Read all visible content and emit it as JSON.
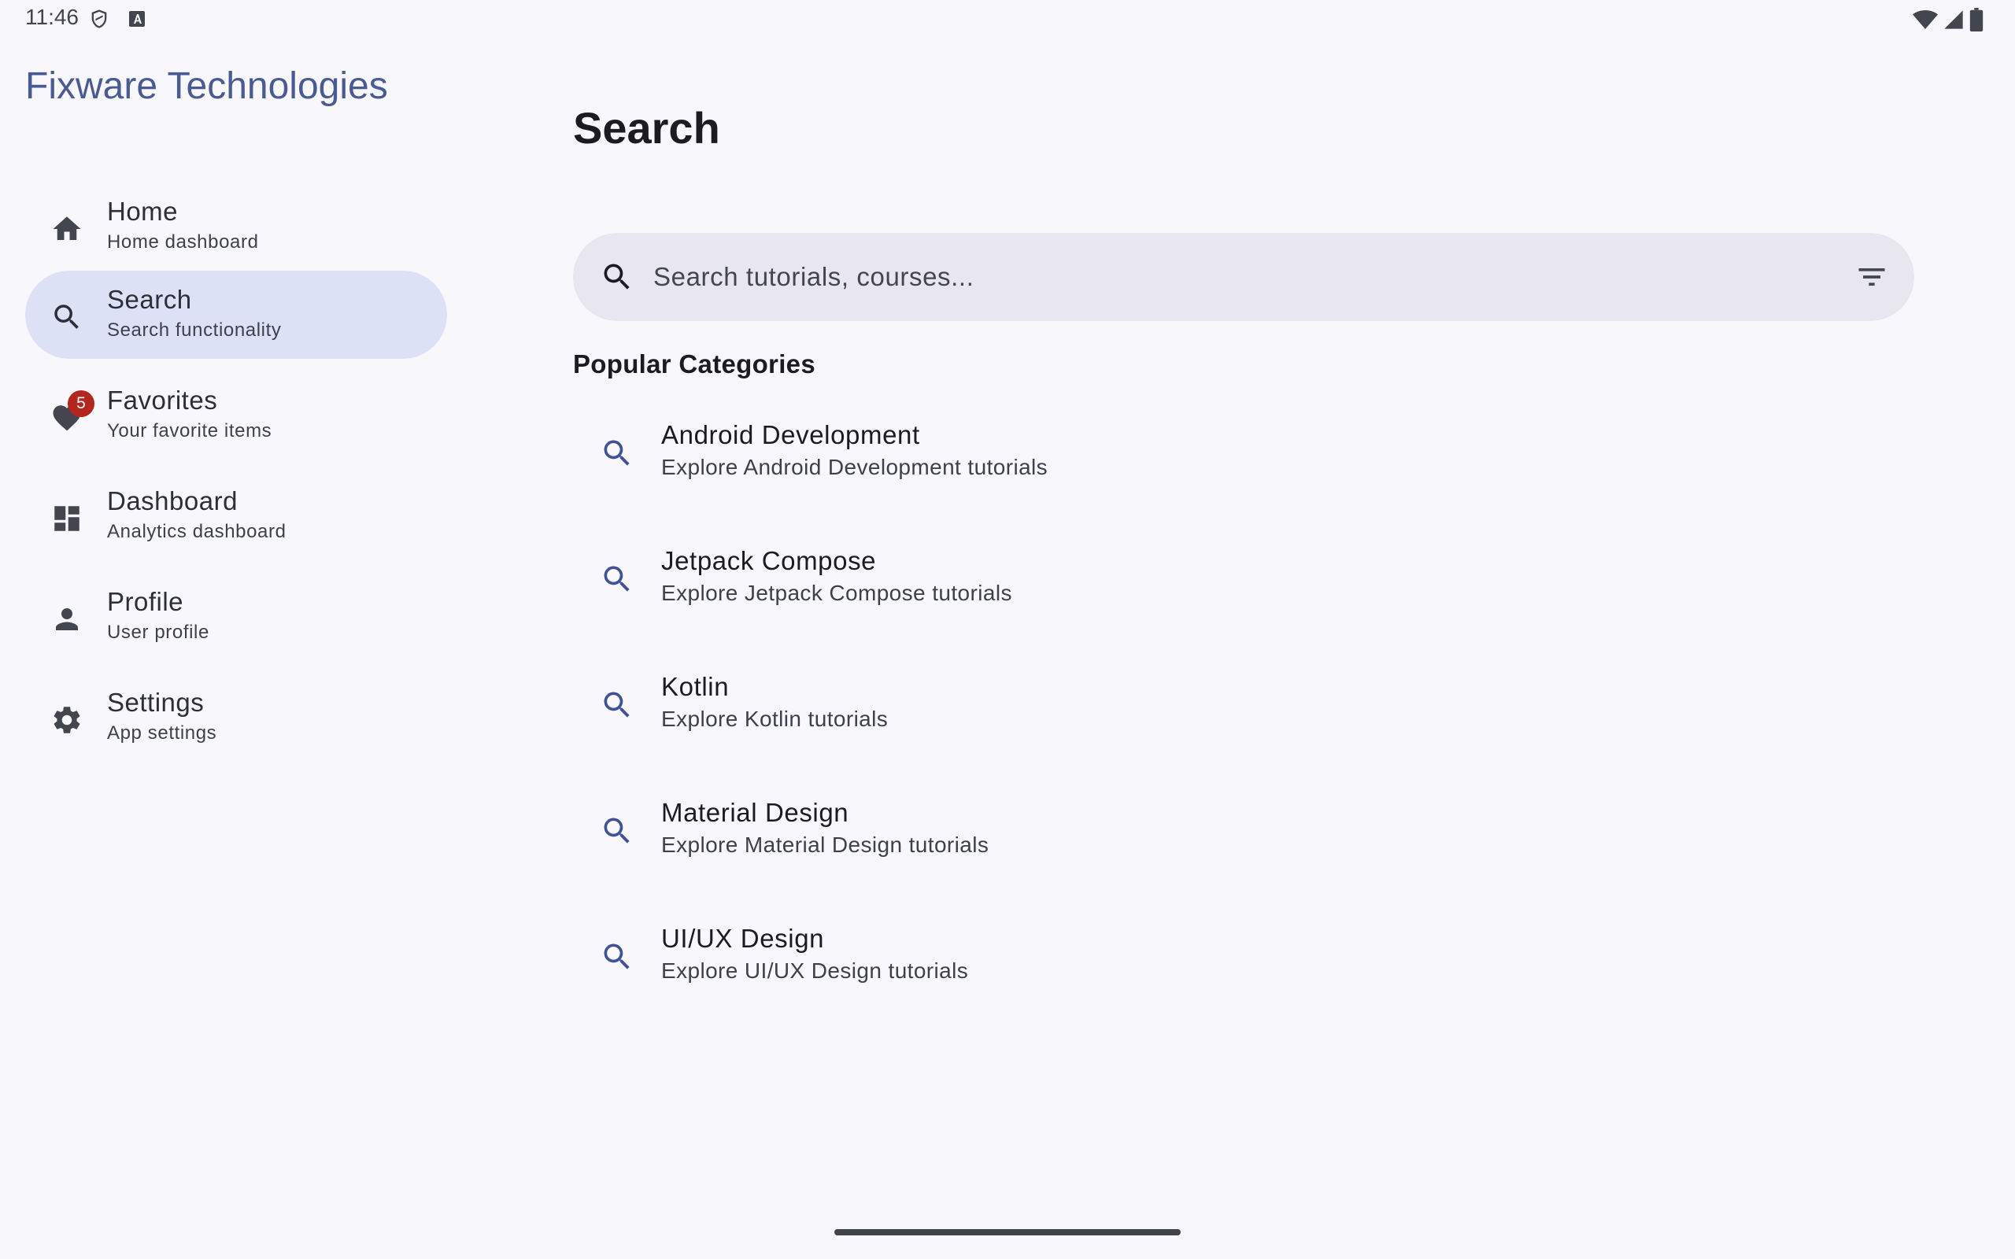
{
  "status_bar": {
    "time": "11:46",
    "left_icons": [
      "shield-icon",
      "a-icon"
    ],
    "right_icons": [
      "wifi-icon",
      "signal-icon",
      "battery-icon"
    ]
  },
  "drawer": {
    "app_title": "Fixware Technologies",
    "items": [
      {
        "label": "Home",
        "subtitle": "Home dashboard",
        "icon": "home-icon",
        "active": false
      },
      {
        "label": "Search",
        "subtitle": "Search functionality",
        "icon": "search-icon",
        "active": true
      },
      {
        "label": "Favorites",
        "subtitle": "Your favorite items",
        "icon": "heart-icon",
        "active": false,
        "badge": "5"
      },
      {
        "label": "Dashboard",
        "subtitle": "Analytics dashboard",
        "icon": "dashboard-icon",
        "active": false
      },
      {
        "label": "Profile",
        "subtitle": "User profile",
        "icon": "person-icon",
        "active": false
      },
      {
        "label": "Settings",
        "subtitle": "App settings",
        "icon": "gear-icon",
        "active": false
      }
    ]
  },
  "main": {
    "title": "Search",
    "search": {
      "placeholder": "Search tutorials, courses...",
      "value": ""
    },
    "section_title": "Popular Categories",
    "categories": [
      {
        "label": "Android Development",
        "subtitle": "Explore Android Development tutorials"
      },
      {
        "label": "Jetpack Compose",
        "subtitle": "Explore Jetpack Compose tutorials"
      },
      {
        "label": "Kotlin",
        "subtitle": "Explore Kotlin tutorials"
      },
      {
        "label": "Material Design",
        "subtitle": "Explore Material Design tutorials"
      },
      {
        "label": "UI/UX Design",
        "subtitle": "Explore UI/UX Design tutorials"
      }
    ]
  },
  "colors": {
    "background": "#F8F7FC",
    "accent_title": "#4A5A92",
    "active_nav": "#DCE1F6",
    "search_bar": "#E8E7F0",
    "badge": "#B3261E",
    "icon_primary": "#3F5394"
  }
}
